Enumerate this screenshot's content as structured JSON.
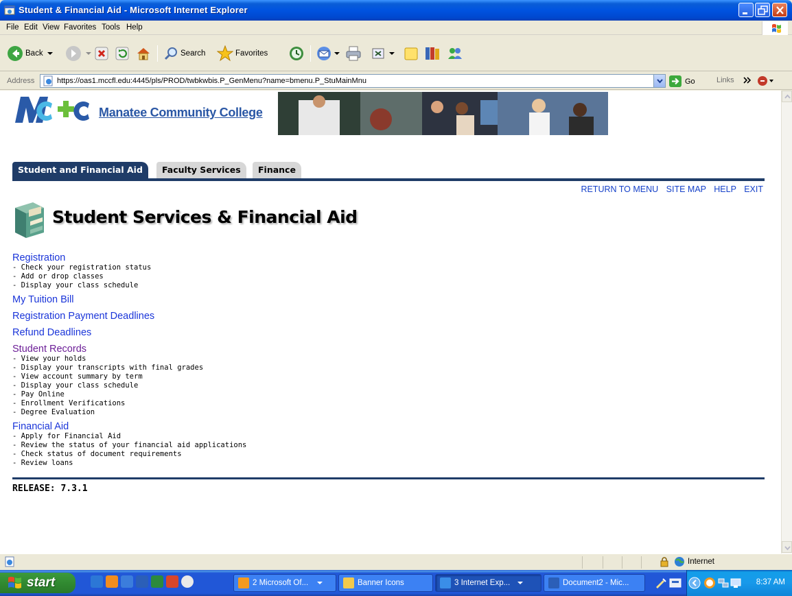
{
  "window": {
    "title": "Student & Financial Aid - Microsoft Internet Explorer"
  },
  "menubar": [
    "File",
    "Edit",
    "View",
    "Favorites",
    "Tools",
    "Help"
  ],
  "toolbar": {
    "back_label": "Back",
    "search_label": "Search",
    "favorites_label": "Favorites"
  },
  "address": {
    "label": "Address",
    "url": "https://oas1.mccfl.edu:4445/pls/PROD/twbkwbis.P_GenMenu?name=bmenu.P_StuMainMnu",
    "go_label": "Go",
    "links_label": "Links"
  },
  "header": {
    "college_name": "Manatee Community College"
  },
  "tabs": [
    {
      "label": "Student and Financial Aid",
      "active": true
    },
    {
      "label": "Faculty Services",
      "active": false
    },
    {
      "label": "Finance",
      "active": false
    }
  ],
  "top_links": [
    "RETURN TO MENU",
    "SITE MAP",
    "HELP",
    "EXIT"
  ],
  "page_title": "Student Services & Financial Aid",
  "menu": [
    {
      "label": "Registration",
      "items": [
        "- Check your registration status",
        "- Add or drop classes",
        "- Display your class schedule"
      ],
      "visited": false
    },
    {
      "label": "My Tuition Bill",
      "items": [],
      "visited": false
    },
    {
      "label": "Registration Payment Deadlines",
      "items": [],
      "visited": false
    },
    {
      "label": "Refund Deadlines",
      "items": [],
      "visited": false
    },
    {
      "label": "Student Records",
      "items": [
        "- View your holds",
        "- Display your transcripts with final grades",
        "- View account summary by term",
        "- Display your class schedule",
        "- Pay Online",
        "- Enrollment Verifications",
        "- Degree Evaluation"
      ],
      "visited": true
    },
    {
      "label": "Financial Aid",
      "items": [
        "- Apply for Financial Aid",
        "- Review the status of your financial aid applications",
        "- Check status of document requirements",
        "- Review loans"
      ],
      "visited": false
    }
  ],
  "release": "RELEASE: 7.3.1",
  "statusbar": {
    "zone": "Internet"
  },
  "taskbar": {
    "start_label": "start",
    "tasks": [
      {
        "label": "2 Microsoft Of...",
        "active": false
      },
      {
        "label": "Banner Icons",
        "active": false
      },
      {
        "label": "3 Internet Exp...",
        "active": true
      },
      {
        "label": "Document2 - Mic...",
        "active": false
      }
    ],
    "clock": "8:37 AM"
  }
}
